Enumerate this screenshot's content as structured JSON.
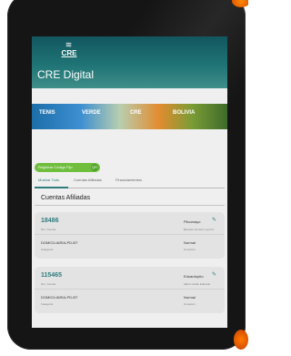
{
  "app": {
    "logo_text": "CRE",
    "title": "CRE Digital"
  },
  "banner": {
    "words": [
      "TENIS",
      "VERDE",
      "CRE",
      "BOLIVIA"
    ]
  },
  "register_button": {
    "label": "Registrar Código Fijo",
    "icon": "qr-icon",
    "icon_glyph": "QR"
  },
  "tabs": [
    {
      "label": "Mostrar Todo",
      "active": true
    },
    {
      "label": "Cuentas Afiliadas",
      "active": false
    },
    {
      "label": "Financiamientos",
      "active": false
    }
  ],
  "section_title": "Cuentas Afiliadas",
  "accounts": [
    {
      "number": "18486",
      "number_caption": "Nro. Cuenta",
      "alias": "Pilcomayo",
      "alias_caption": "Benanio Gomes | a.pd N",
      "category": "DOMICILIARIA-PD-BT",
      "category_caption": "Categoría",
      "connection": "Normal",
      "connection_caption": "Conexión"
    },
    {
      "number": "115465",
      "number_caption": "Nro. Cuenta",
      "alias": "Eduardopito",
      "alias_caption": "Aljhre Castle Eduardo",
      "category": "DOMICILIARIA-PD-BT",
      "category_caption": "Categoría",
      "connection": "Normal",
      "connection_caption": "Conexión"
    }
  ],
  "colors": {
    "teal": "#2f7c7d",
    "green": "#6fbe3d",
    "header_dark": "#12565f"
  }
}
